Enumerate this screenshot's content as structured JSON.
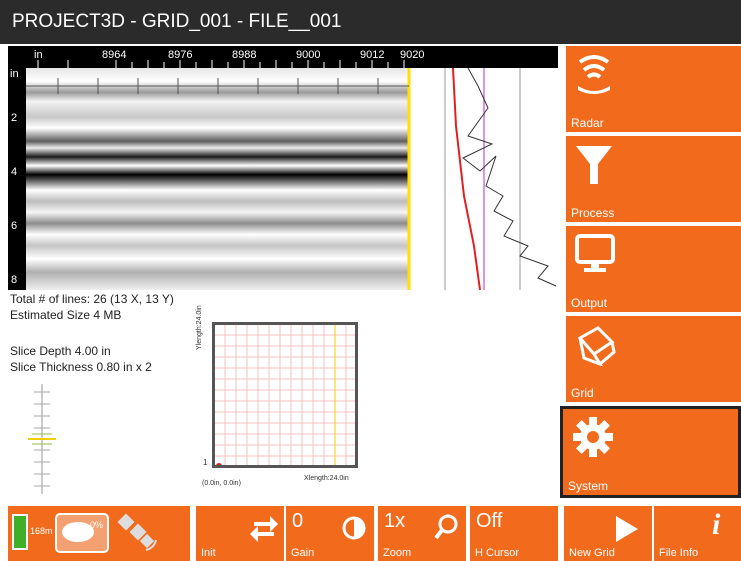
{
  "title": "PROJECT3D - GRID_001 - FILE__001",
  "scan": {
    "x_unit": "in",
    "x_ticks": [
      "8964",
      "8976",
      "8988",
      "9000",
      "9012",
      "9020"
    ],
    "depth_unit": "in",
    "depth_ticks": [
      "2",
      "4",
      "6",
      "8"
    ]
  },
  "info": {
    "total_lines": "Total # of lines: 26 (13 X, 13 Y)",
    "estimated_size": "Estimated Size 4 MB",
    "slice_depth": "Slice Depth 4.00 in",
    "slice_thickness": "Slice Thickness 0.80 in x 2"
  },
  "grid_preview": {
    "y_label": "Ylength:24.0in",
    "x_label": "Xlength:24.0in",
    "origin_label": "(0.0in, 0.0in)",
    "corner_number": "1"
  },
  "side_menu": [
    {
      "label": "Radar",
      "icon": "radar-icon"
    },
    {
      "label": "Process",
      "icon": "funnel-icon"
    },
    {
      "label": "Output",
      "icon": "monitor-icon"
    },
    {
      "label": "Grid",
      "icon": "cube-icon"
    },
    {
      "label": "System",
      "icon": "gear-icon"
    }
  ],
  "status": {
    "battery": "168m",
    "disk": "0%"
  },
  "toolbar": {
    "init": {
      "label": "Init",
      "icon": "swap-icon"
    },
    "gain": {
      "value": "0",
      "label": "Gain",
      "icon": "contrast-icon"
    },
    "zoom": {
      "value": "1x",
      "label": "Zoom",
      "icon": "magnifier-icon"
    },
    "hcursor": {
      "value": "Off",
      "label": "H Cursor"
    },
    "new_grid": {
      "label": "New Grid",
      "icon": "play-icon"
    },
    "file_info": {
      "label": "File Info",
      "icon": "info-icon"
    }
  },
  "colors": {
    "accent": "#f26b1d",
    "titlebar": "#2b2b2b"
  }
}
